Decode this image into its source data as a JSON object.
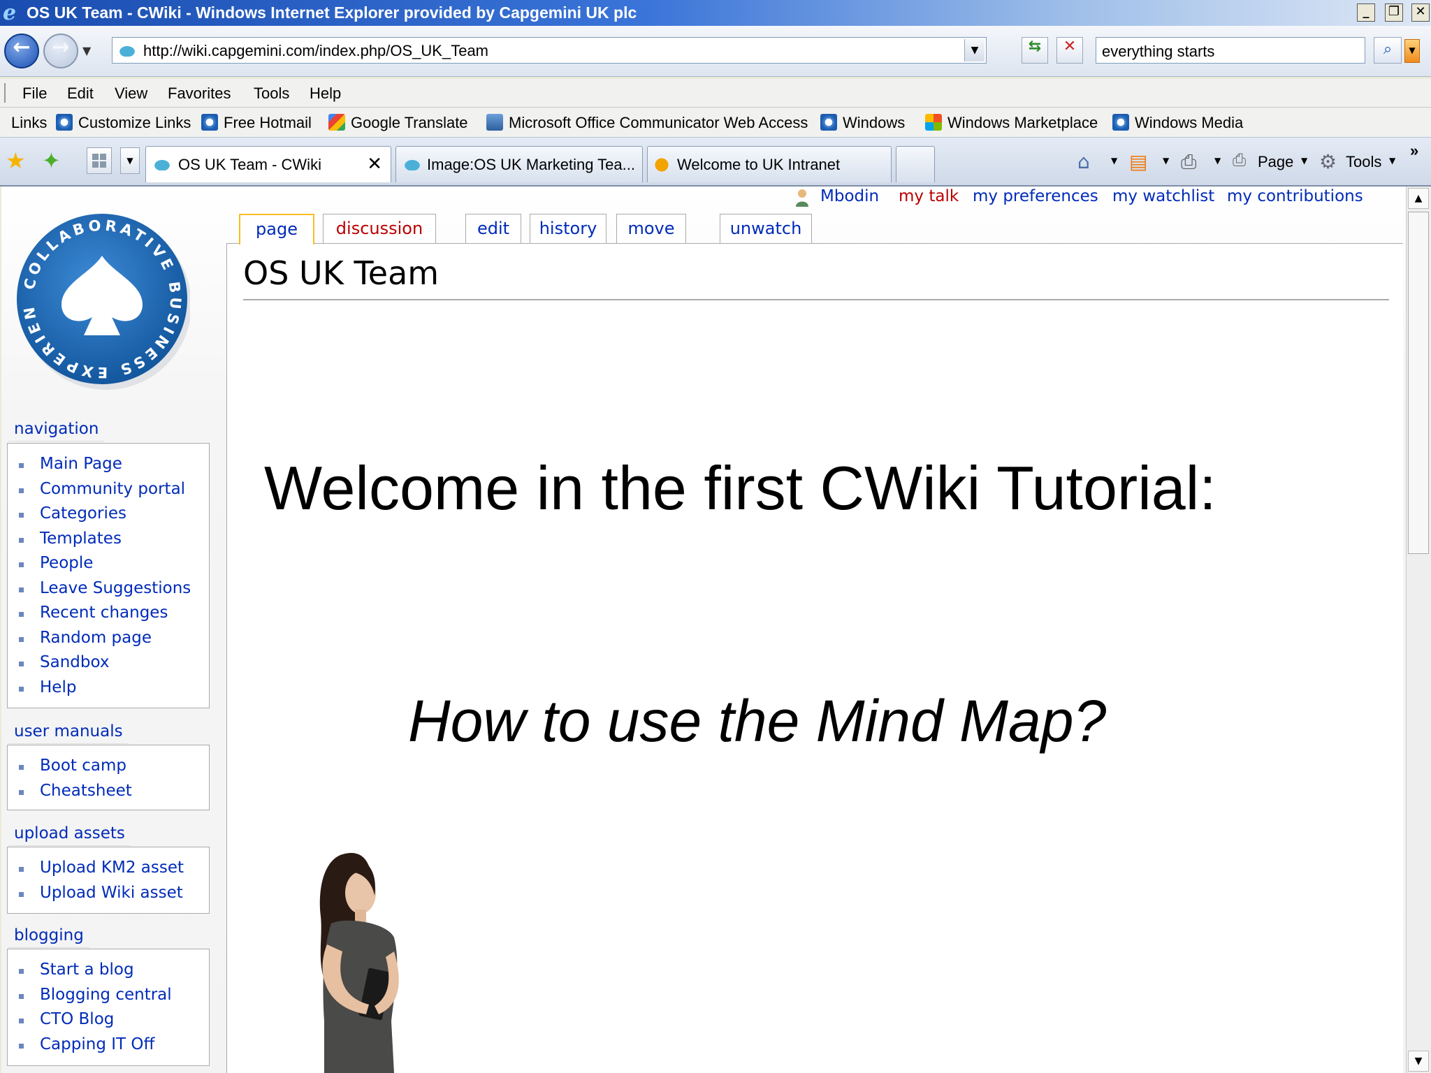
{
  "window": {
    "title": "OS UK Team - CWiki - Windows Internet Explorer provided by Capgemini UK plc",
    "controls": [
      "_",
      "❐",
      "✕"
    ]
  },
  "address_bar": {
    "url": "http://wiki.capgemini.com/index.php/OS_UK_Team",
    "search_value": "everything starts"
  },
  "menu": [
    "File",
    "Edit",
    "View",
    "Favorites",
    "Tools",
    "Help"
  ],
  "links_bar": {
    "label": "Links",
    "items": [
      {
        "label": "Customize Links",
        "icon": "ie-page-icon"
      },
      {
        "label": "Free Hotmail",
        "icon": "ie-page-icon"
      },
      {
        "label": "Google Translate",
        "icon": "google-icon"
      },
      {
        "label": "Microsoft Office Communicator Web Access",
        "icon": "communicator-icon"
      },
      {
        "label": "Windows",
        "icon": "ie-page-icon"
      },
      {
        "label": "Windows Marketplace",
        "icon": "windows-flag-icon"
      },
      {
        "label": "Windows Media",
        "icon": "ie-page-icon"
      }
    ]
  },
  "tabs": [
    {
      "label": "OS UK Team - CWiki",
      "active": true
    },
    {
      "label": "Image:OS UK Marketing Tea...",
      "active": false
    },
    {
      "label": "Welcome to UK Intranet",
      "active": false
    }
  ],
  "command_bar": {
    "page_label": "Page",
    "tools_label": "Tools",
    "chevron": "»"
  },
  "personal_tools": {
    "user": "Mbodin",
    "talk": "my talk",
    "preferences": "my preferences",
    "watchlist": "my watchlist",
    "contributions": "my contributions"
  },
  "page_tabs": [
    "page",
    "discussion",
    "edit",
    "history",
    "move",
    "unwatch"
  ],
  "article": {
    "heading": "OS UK Team",
    "slide_title": "Welcome in the first CWiki Tutorial:",
    "slide_subtitle": "How to use the Mind Map?"
  },
  "logo": {
    "text": "COLLABORATIVE BUSINESS EXPERIENCE"
  },
  "sidebar": {
    "navigation": {
      "title": "navigation",
      "items": [
        "Main Page",
        "Community portal",
        "Categories",
        "Templates",
        "People",
        "Leave Suggestions",
        "Recent changes",
        "Random page",
        "Sandbox",
        "Help"
      ]
    },
    "user_manuals": {
      "title": "user manuals",
      "items": [
        "Boot camp",
        "Cheatsheet"
      ]
    },
    "upload_assets": {
      "title": "upload assets",
      "items": [
        "Upload KM2 asset",
        "Upload Wiki asset"
      ]
    },
    "blogging": {
      "title": "blogging",
      "items": [
        "Start a blog",
        "Blogging central",
        "CTO Blog",
        "Capping IT Off"
      ]
    }
  },
  "colors": {
    "link": "#002bb8",
    "new_link": "#ba0000",
    "selected_tab_border": "#fabd23",
    "logo_blue": "#1f6fc0"
  }
}
